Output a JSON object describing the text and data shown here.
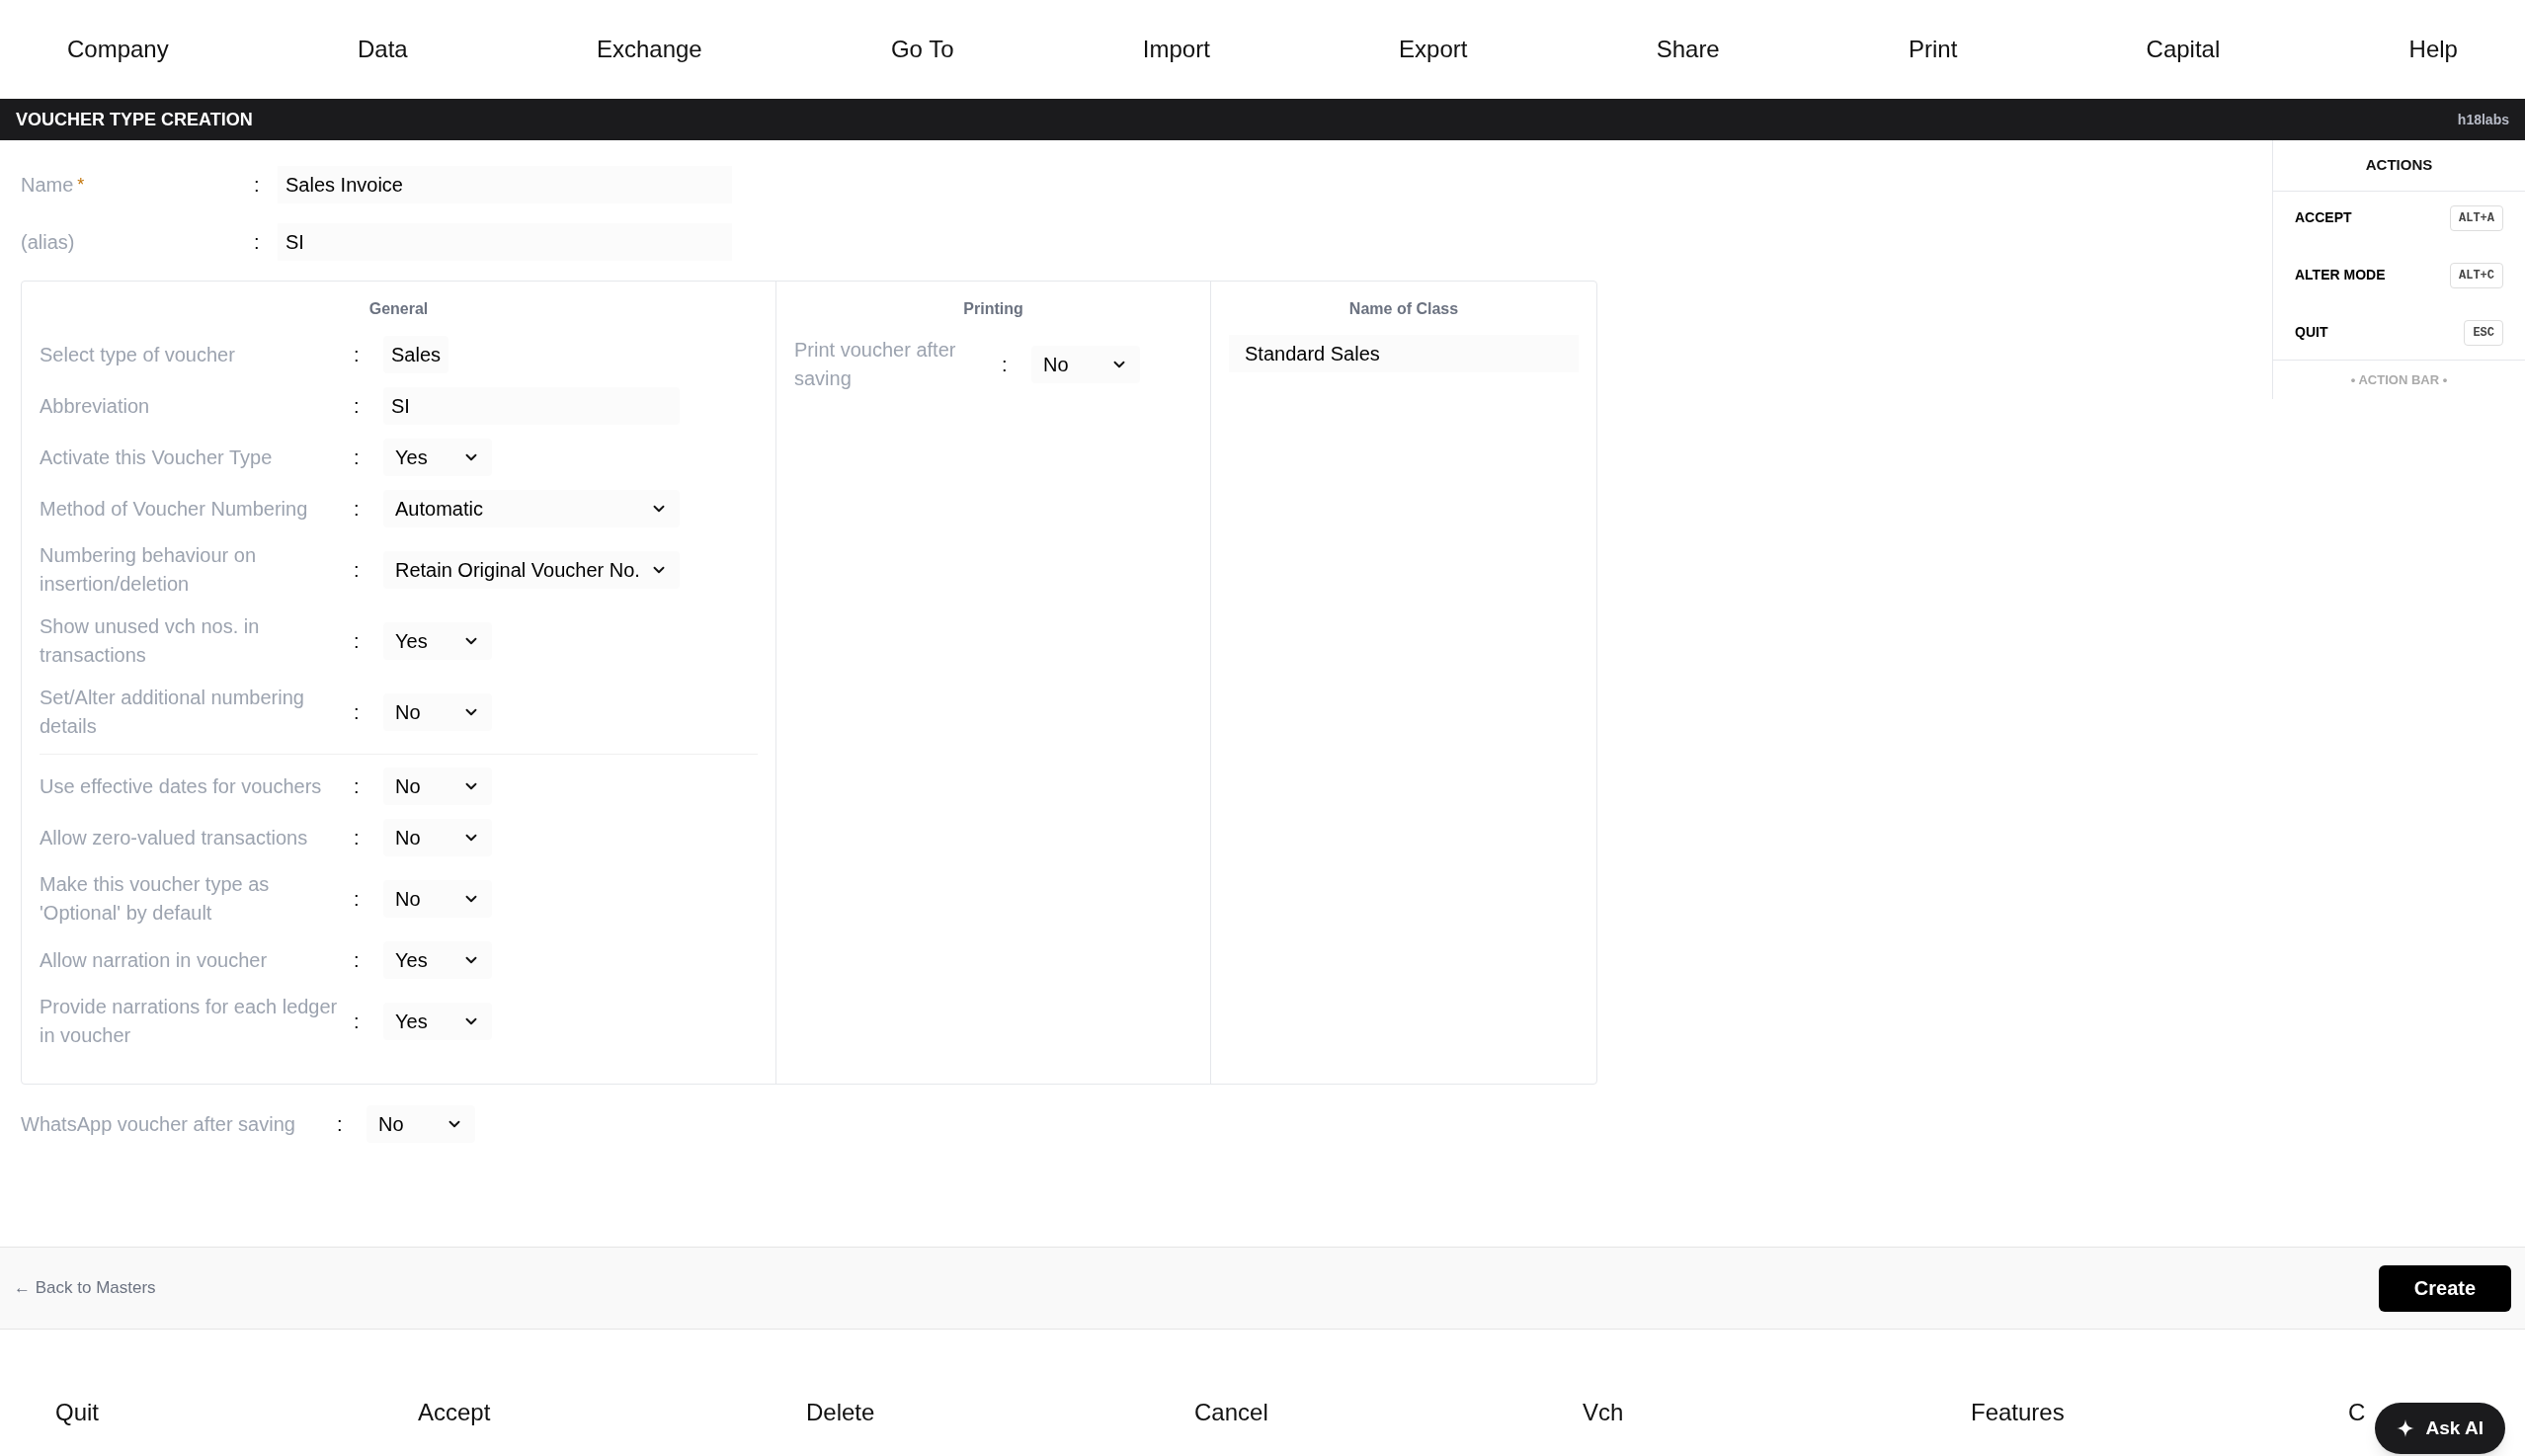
{
  "menu": [
    "Company",
    "Data",
    "Exchange",
    "Go To",
    "Import",
    "Export",
    "Share",
    "Print",
    "Capital",
    "Help"
  ],
  "title_bar": {
    "title": "VOUCHER TYPE CREATION",
    "brand": "h18labs"
  },
  "header_fields": [
    {
      "label": "Name",
      "required_mark": "*",
      "sep": ":",
      "value": "Sales Invoice"
    },
    {
      "label": "(alias)",
      "sep": ":",
      "value": "SI"
    }
  ],
  "general": {
    "heading": "General",
    "groups": [
      {
        "rows": [
          {
            "label": "Select type of voucher",
            "sep": ":",
            "kind": "text",
            "value": "Sales"
          },
          {
            "label": "Abbreviation",
            "sep": ":",
            "kind": "wide_text",
            "value": "SI"
          },
          {
            "label": "Activate this Voucher Type",
            "sep": ":",
            "kind": "select",
            "value": "Yes"
          },
          {
            "label": "Method of Voucher Numbering",
            "sep": ":",
            "kind": "wide_select",
            "value": "Automatic"
          },
          {
            "label": "Numbering behaviour on insertion/deletion",
            "sep": ":",
            "kind": "wide_select",
            "value": "Retain Original Voucher No."
          },
          {
            "label": "Show unused vch nos. in transactions",
            "sep": ":",
            "kind": "select",
            "value": "Yes"
          },
          {
            "label": "Set/Alter additional numbering details",
            "sep": ":",
            "kind": "select",
            "value": "No"
          }
        ]
      },
      {
        "rows": [
          {
            "label": "Use effective dates for vouchers",
            "sep": ":",
            "kind": "select",
            "value": "No"
          },
          {
            "label": "Allow zero-valued transactions",
            "sep": ":",
            "kind": "select",
            "value": "No"
          },
          {
            "label": "Make this voucher type as 'Optional' by default",
            "sep": ":",
            "kind": "select",
            "value": "No"
          },
          {
            "label": "Allow narration in voucher",
            "sep": ":",
            "kind": "select",
            "value": "Yes"
          },
          {
            "label": "Provide narrations for each ledger in voucher",
            "sep": ":",
            "kind": "select",
            "value": "Yes"
          }
        ]
      }
    ]
  },
  "printing": {
    "heading": "Printing",
    "rows": [
      {
        "label": "Print voucher after saving",
        "sep": ":",
        "kind": "select",
        "value": "No"
      }
    ]
  },
  "name_of_class": {
    "heading": "Name of Class",
    "value": "Standard Sales"
  },
  "whatsapp": {
    "label": "WhatsApp voucher after saving",
    "sep": ":",
    "kind": "select",
    "value": "No"
  },
  "actions": {
    "heading": "ACTIONS",
    "items": [
      {
        "label": "ACCEPT",
        "shortcut": "ALT+A"
      },
      {
        "label": "ALTER MODE",
        "shortcut": "ALT+C"
      },
      {
        "label": "QUIT",
        "shortcut": "ESC"
      }
    ],
    "footer": "• ACTION BAR •"
  },
  "footer": {
    "back_link": "← Back to Masters",
    "create_button": "Create"
  },
  "function_bar": [
    "Quit",
    "Accept",
    "Delete",
    "Cancel",
    "Vch",
    "Features",
    "C"
  ],
  "ask_ai": "Ask AI"
}
